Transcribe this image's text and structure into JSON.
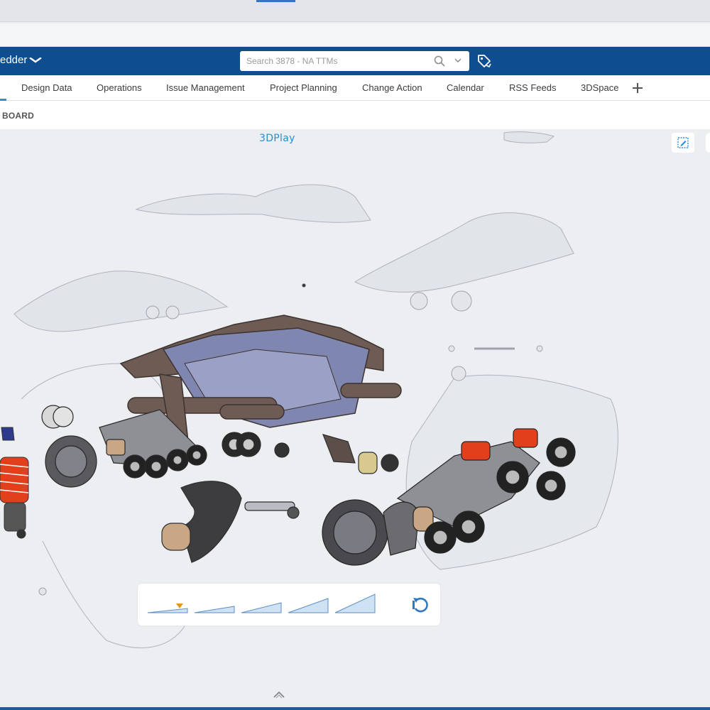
{
  "app": {
    "title": "edder",
    "search_placeholder": "Search 3878 - NA TTMs"
  },
  "tabs": [
    {
      "label": "Design Data"
    },
    {
      "label": "Operations"
    },
    {
      "label": "Issue Management"
    },
    {
      "label": "Project Planning"
    },
    {
      "label": "Change Action"
    },
    {
      "label": "Calendar"
    },
    {
      "label": "RSS Feeds"
    },
    {
      "label": "3DSpace"
    }
  ],
  "board": {
    "label": "BOARD"
  },
  "viewer": {
    "title": "3DPlay",
    "explode_slider": {
      "steps": 5,
      "selected_step": 1
    }
  },
  "colors": {
    "brand_blue": "#0e4d8f",
    "accent_blue": "#2a8fd0",
    "spring_red": "#e2401c",
    "frame_brown": "#6e5b54",
    "part_blue": "#7f86b0",
    "marker_orange": "#e8951e"
  },
  "icons": {
    "search": "search-icon",
    "dropdown": "chevron-down-icon",
    "tag": "tag-icon",
    "add": "plus-icon",
    "edit": "edit-icon",
    "reset": "reset-icon",
    "collapse": "chevron-up-icon"
  }
}
